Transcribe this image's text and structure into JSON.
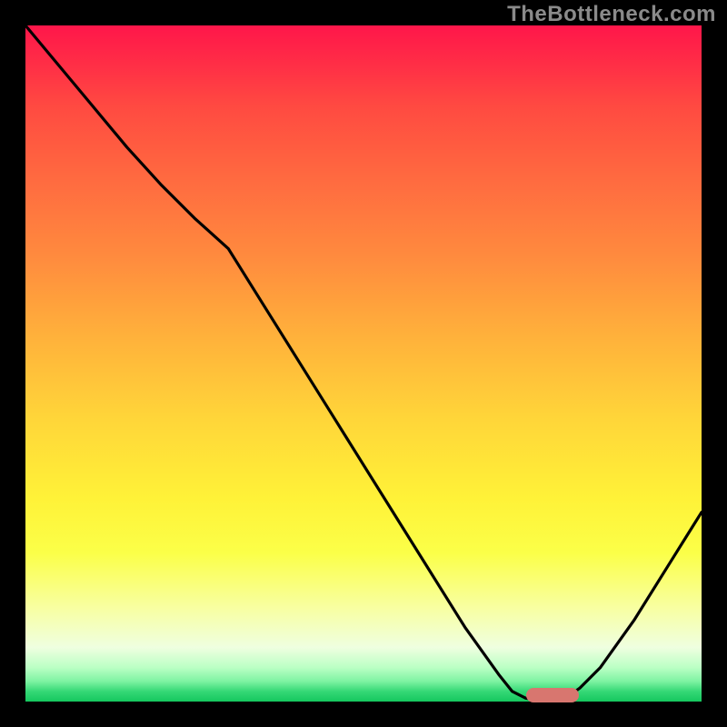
{
  "watermark": "TheBottleneck.com",
  "colors": {
    "background": "#000000",
    "gradient_top": "#ff164a",
    "gradient_bottom": "#15c75e",
    "curve": "#000000",
    "marker": "#d8766f"
  },
  "chart_data": {
    "type": "line",
    "title": "",
    "xlabel": "",
    "ylabel": "",
    "xlim": [
      0,
      100
    ],
    "ylim": [
      0,
      100
    ],
    "x": [
      0,
      5,
      10,
      15,
      20,
      25,
      30,
      35,
      40,
      45,
      50,
      55,
      60,
      65,
      70,
      72,
      74,
      76,
      78,
      80,
      82,
      85,
      90,
      95,
      100
    ],
    "values": [
      100,
      94,
      88,
      82,
      76.5,
      71.5,
      67,
      59,
      51,
      43,
      35,
      27,
      19,
      11,
      4,
      1.5,
      0.5,
      0.2,
      0.2,
      0.5,
      2,
      5,
      12,
      20,
      28
    ],
    "annotations": [
      {
        "type": "marker",
        "x": 78,
        "y": 1,
        "width_pct": 7.8,
        "label": ""
      }
    ]
  }
}
